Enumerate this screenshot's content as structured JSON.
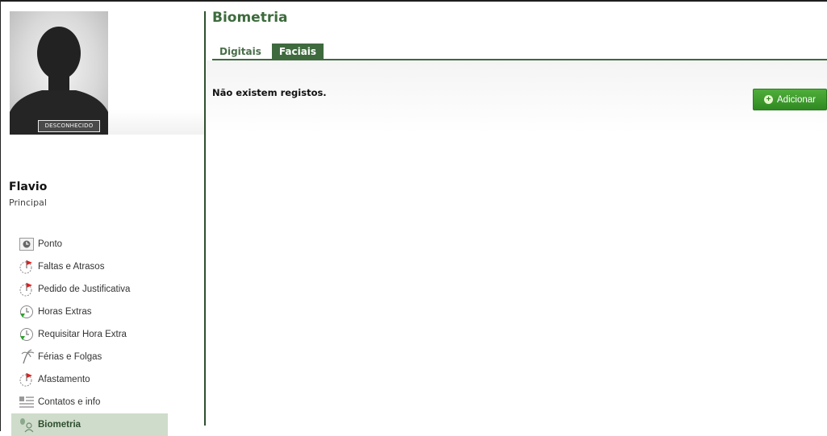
{
  "profile": {
    "photo_badge": "DESCONHECIDO",
    "name": "Flavio",
    "role": "Principal"
  },
  "menu": {
    "items": [
      {
        "label": "Ponto",
        "icon": "clock-box-icon"
      },
      {
        "label": "Faltas e Atrasos",
        "icon": "clock-flag-red-icon"
      },
      {
        "label": "Pedido de Justificativa",
        "icon": "clock-flag-red-icon"
      },
      {
        "label": "Horas Extras",
        "icon": "clock-arrow-green-icon"
      },
      {
        "label": "Requisitar Hora Extra",
        "icon": "clock-arrow-green-icon"
      },
      {
        "label": "Férias e Folgas",
        "icon": "palm-tree-icon"
      },
      {
        "label": "Afastamento",
        "icon": "clock-flag-red-icon"
      },
      {
        "label": "Contatos e info",
        "icon": "contact-list-icon"
      },
      {
        "label": "Biometria",
        "icon": "fingerprint-person-icon",
        "active": true
      }
    ]
  },
  "main": {
    "title": "Biometria",
    "tabs": [
      {
        "label": "Digitais"
      },
      {
        "label": "Faciais",
        "selected": true
      }
    ],
    "empty_message": "Não existem registos.",
    "add_button": "Adicionar"
  },
  "colors": {
    "accent_green": "#3e6a3e",
    "button_green": "#3a9a2a",
    "active_menu_bg": "#cfdccb",
    "flag_red": "#e02020"
  }
}
